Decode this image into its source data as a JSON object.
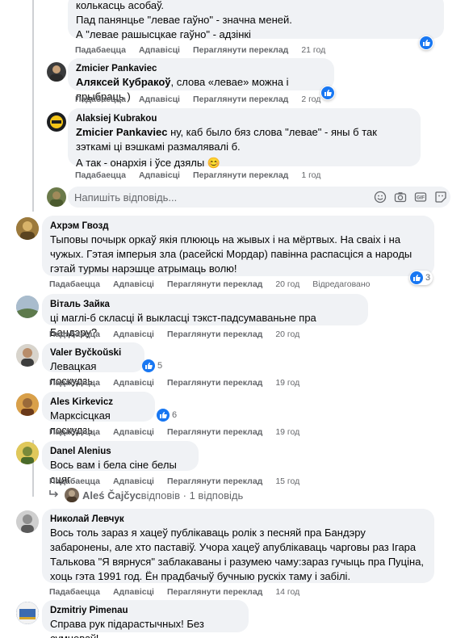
{
  "actions": {
    "like": "Падабаецца",
    "reply": "Адпавісці",
    "translate": "Пераглянути переклад",
    "edited": "Відредаговано"
  },
  "top_comment": {
    "lines": [
      "колькасць асобаў.",
      "Пад панянцье \"левае гаўно\" - значна меней.",
      "А \"левае рашысцкае гаўно\" - адзінкі"
    ],
    "time": "21 год"
  },
  "replies": [
    {
      "author": "Zmicier Pankaviec",
      "mention": "Аляксей Кубракоў",
      "text": ", слова «левае» можна і прыбраць )",
      "time": "2 год"
    },
    {
      "author": "Alaksiej Kubrakou",
      "mention": "Zmicier Pankaviec",
      "text": " ну, каб было бяз слова \"левае\" - яны б так зэткамі ці вэшкамі размалявалі б.",
      "text2": "А так - онархія і ўсе дзялы 😊",
      "time": "1 год"
    }
  ],
  "reply_box": {
    "placeholder": "Напишіть відповідь..."
  },
  "comments": [
    {
      "author": "Ахрэм Гвозд",
      "text": "Тыповы почырк оркаў якія плююць на жывых і на мёртвых. На сваіх і на чужых. Гэтая імперыя зла (расейскі Мордар) павінна распасціся а народы гэтай турмы нарэшце атрымаць волю!",
      "time": "20 год",
      "reactions": "3"
    },
    {
      "author": "Віталь Зайка",
      "text": "ці маглі-б скласці й выкласці тэкст-падсумаваньне пра Бандэру?",
      "time": "20 год"
    },
    {
      "author": "Valer Byčkoŭski",
      "text": "Левацкая поскудзь",
      "time": "19 год",
      "reactions": "5"
    },
    {
      "author": "Ales Kirkevicz",
      "text": "Марксісцкая поскудзь",
      "time": "19 год",
      "reactions": "6"
    },
    {
      "author": "Danel Alenius",
      "text": "Вось вам і бела сіне белы сцяг",
      "time": "15 год"
    },
    {
      "author": "Николай Левчук",
      "text": "Вось толь зараз я хацеў публікаваць ролік з песняй пра Бандэру забаронены, але хто паставіў. Учора хацеў апублікаваць чарговы раз Ігара Талькова \"Я вярнуся\" заблакаваны і разумею чаму:зараз гучыць пра Пуціна, хоць гэта 1991 год. Ён прадбачыў бучныю рускіх таму і забілі.",
      "time": "14 год"
    },
    {
      "author": "Dzmitriy Pimenau",
      "text": "Справа рук підарастычных! Без сумневаў!",
      "time": ""
    }
  ],
  "view_replies": {
    "author": "Aleś Čajčус",
    "suffix": " відповів · 1 відповідь"
  },
  "colors": {
    "like_blue": "#1877f2",
    "bubble_bg": "#f0f2f5",
    "muted": "#65676b"
  }
}
